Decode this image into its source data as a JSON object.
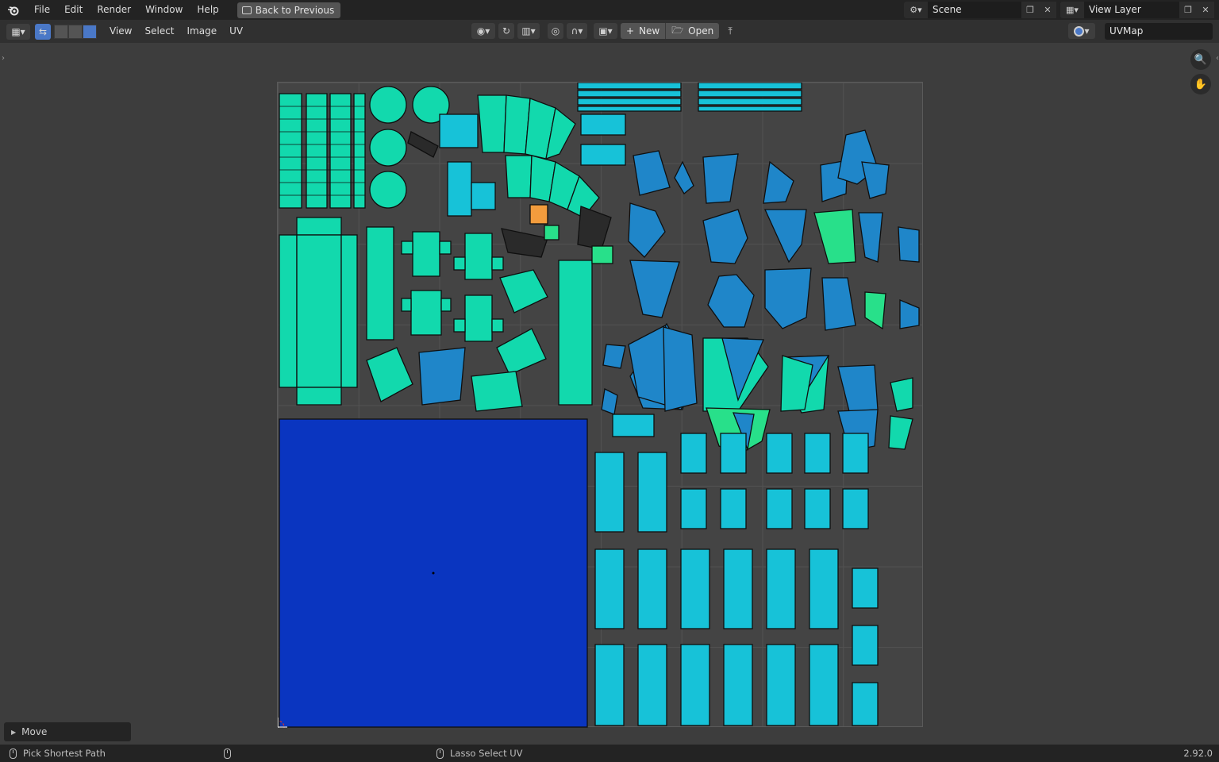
{
  "topbar": {
    "menus": [
      "File",
      "Edit",
      "Render",
      "Window",
      "Help"
    ],
    "back_button": "Back to Previous",
    "scene": "Scene",
    "view_layer": "View Layer"
  },
  "header": {
    "menus": [
      "View",
      "Select",
      "Image",
      "UV"
    ],
    "new_label": "New",
    "open_label": "Open",
    "uv_map": "UVMap"
  },
  "panel": {
    "last_operator": "Move"
  },
  "status": {
    "left_hint": "Pick Shortest Path",
    "middle_hint": "Lasso Select UV",
    "version": "2.92.0"
  },
  "colors": {
    "teal_island": "#12d9ad",
    "cyan_island": "#17c2d8",
    "blue_island": "#1f86c9",
    "green_island": "#28e08a",
    "deep_blue_island": "#0a35c0",
    "accent": "#4a78c7"
  },
  "icons": [
    "blender-logo",
    "back-icon",
    "scene-icon",
    "view-layer-icon",
    "new-icon",
    "open-icon",
    "pin-icon",
    "zoom-icon",
    "hand-icon",
    "cursor-icon"
  ]
}
